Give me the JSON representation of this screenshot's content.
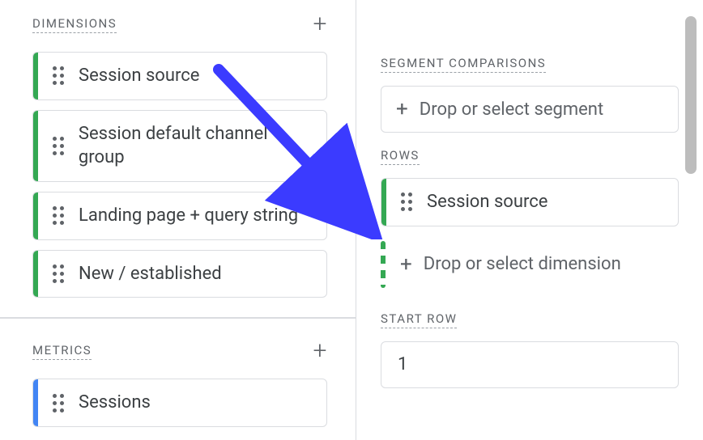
{
  "left": {
    "dimensions": {
      "label": "DIMENSIONS",
      "items": [
        {
          "label": "Session source"
        },
        {
          "label": "Session default channel group"
        },
        {
          "label": "Landing page + query string"
        },
        {
          "label": "New / established"
        }
      ]
    },
    "metrics": {
      "label": "METRICS",
      "items": [
        {
          "label": "Sessions"
        }
      ]
    }
  },
  "right": {
    "segment_comparisons": {
      "label": "SEGMENT COMPARISONS",
      "drop_text": "Drop or select segment"
    },
    "rows": {
      "label": "ROWS",
      "chip": "Session source",
      "drop_text": "Drop or select dimension"
    },
    "start_row": {
      "label": "START ROW",
      "value": "1"
    }
  }
}
